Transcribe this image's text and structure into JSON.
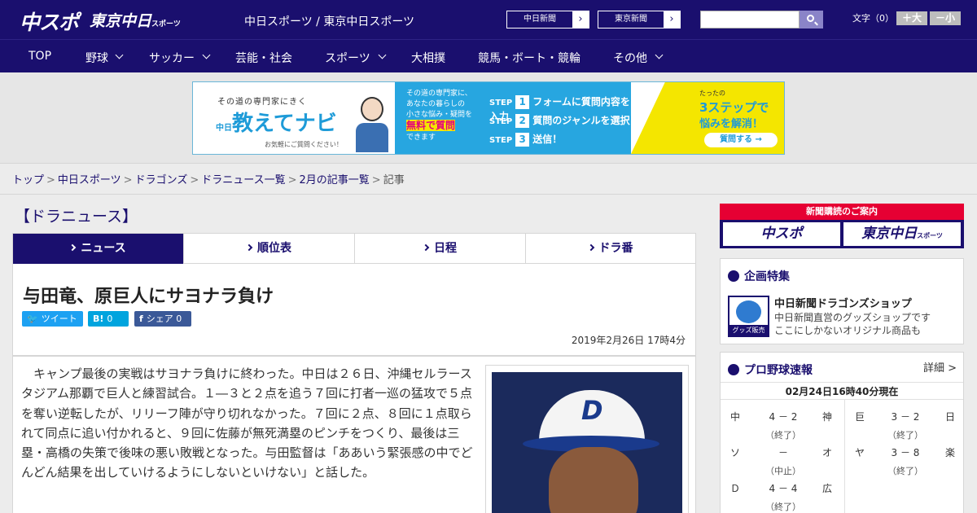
{
  "header": {
    "logo_main": "中スポ",
    "logo_sub": "東京中日",
    "logo_sub_small": "スポーツ",
    "site_title": "中日スポーツ / 東京中日スポーツ",
    "ext_links": [
      "中日新聞",
      "東京新聞"
    ],
    "font_label": "文字（0）",
    "font_large": "＋大",
    "font_small": "－小"
  },
  "nav": {
    "items": [
      "TOP",
      "野球",
      "サッカー",
      "芸能・社会",
      "スポーツ",
      "大相撲",
      "競馬・ボート・競輪",
      "その他"
    ]
  },
  "ad": {
    "tagline": "その道の専門家にきく",
    "logo_prefix": "中日",
    "logo": "教えてナビ",
    "note": "お気軽にご質問ください！",
    "mid_line1": "その道の専門家に、",
    "mid_line2": "あなたの暮らしの",
    "mid_line3": "小さな悩み・疑問を",
    "mid_highlight": "無料で質問",
    "mid_line4": "できます",
    "step_label": "STEP",
    "steps": [
      {
        "num": "1",
        "text": "フォームに質問内容を入力"
      },
      {
        "num": "2",
        "text": "質問のジャンルを選択"
      },
      {
        "num": "3",
        "text": "送信！"
      }
    ],
    "right1": "たったの",
    "right2": "3ステップで",
    "right3": "悩みを解消！",
    "button": "質問する →"
  },
  "breadcrumb": {
    "items": [
      "トップ",
      "中日スポーツ",
      "ドラゴンズ",
      "ドラニュース一覧",
      "2月の記事一覧"
    ],
    "current": "記事"
  },
  "section": {
    "title": "【ドラニュース】"
  },
  "tabs": [
    "ニュース",
    "順位表",
    "日程",
    "ドラ番"
  ],
  "article": {
    "headline": "与田竜、原巨人にサヨナラ負け",
    "share": {
      "tweet": "ツイート",
      "hatena_glyph": "B!",
      "hatena_count": "0",
      "fb_glyph": "f",
      "fb_label": "シェア",
      "fb_count": "0"
    },
    "date": "2019年2月26日 17時4分",
    "body": "キャンプ最後の実戦はサヨナラ負けに終わった。中日は２６日、沖縄セルラースタジアム那覇で巨人と練習試合。１―３と２点を追う７回に打者一巡の猛攻で５点を奪い逆転したが、リリーフ陣が守り切れなかった。７回に２点、８回に１点取られて同点に追い付かれると、９回に佐藤が無死満塁のピンチをつくり、最後は三塁・高橋の失策で後味の悪い敗戦となった。与田監督は「ああいう緊張感の中でどんどん結果を出していけるようにしないといけない」と話した。",
    "photo_logo": "D"
  },
  "sidebar": {
    "subscription": {
      "header": "新聞購読のご案内",
      "logo1": "中スポ",
      "logo2": "東京中日",
      "logo2_small": "スポーツ"
    },
    "feature": {
      "title": "企画特集",
      "shop_label": "グッズ販売中",
      "shop_title": "中日新聞ドラゴンズショップ",
      "shop_desc1": "中日新聞直営のグッズショップです",
      "shop_desc2": "ここにしかないオリジナル商品も"
    },
    "scores": {
      "title": "プロ野球速報",
      "detail": "詳細 >",
      "time": "02月24日16時40分現在",
      "games": [
        {
          "home": "中",
          "score": "4 － 2",
          "away": "神",
          "status": "（終了）"
        },
        {
          "home": "巨",
          "score": "3 － 2",
          "away": "日",
          "status": "（終了）"
        },
        {
          "home": "ソ",
          "score": "－",
          "away": "オ",
          "status": "（中止）"
        },
        {
          "home": "ヤ",
          "score": "3 － 8",
          "away": "楽",
          "status": "（終了）"
        },
        {
          "home": "Ｄ",
          "score": "4 － 4",
          "away": "広",
          "status": "（終了）"
        }
      ]
    }
  }
}
